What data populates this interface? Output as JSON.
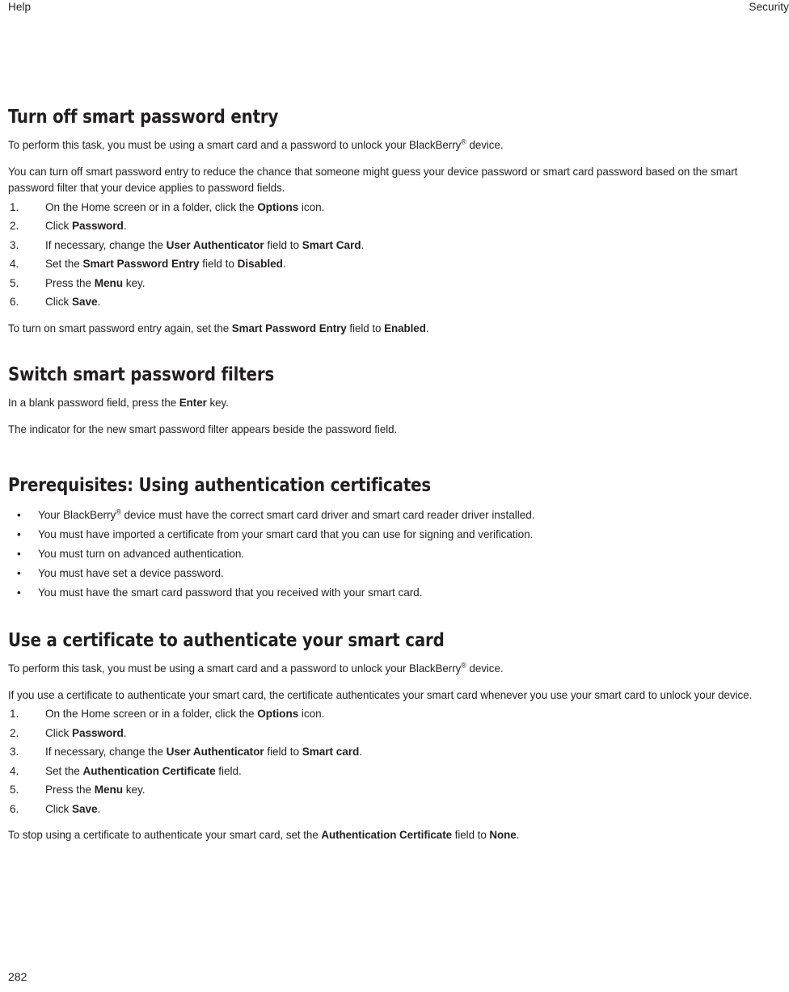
{
  "header": {
    "left": "Help",
    "right": "Security"
  },
  "footer": {
    "page_number": "282"
  },
  "sections": [
    {
      "id": "turn-off-smart-password-entry",
      "title": "Turn off smart password entry",
      "intro": "To perform this task, you must be using a smart card and a password to unlock your BlackBerry® device.",
      "description": "You can turn off smart password entry to reduce the chance that someone might guess your device password or smart card password based on the smart password filter that your device applies to password fields.",
      "steps": [
        {
          "num": "1.",
          "text": "On the Home screen or in a folder, click the Options icon."
        },
        {
          "num": "2.",
          "text": "Click Password."
        },
        {
          "num": "3.",
          "text": "If necessary, change the User Authenticator field to Smart Card."
        },
        {
          "num": "4.",
          "text": "Set the Smart Password Entry field to Disabled."
        },
        {
          "num": "5.",
          "text": "Press the Menu key."
        },
        {
          "num": "6.",
          "text": "Click Save."
        }
      ],
      "closing": "To turn on smart password entry again, set the Smart Password Entry field to Enabled."
    },
    {
      "id": "switch-smart-password-filters",
      "title": "Switch smart password filters",
      "intro": "In a blank password field, press the Enter key.",
      "closing": "The indicator for the new smart password filter appears beside the password field."
    },
    {
      "id": "prerequisites-using-authentication-certificates",
      "title": "Prerequisites: Using authentication certificates",
      "bullets": [
        "Your BlackBerry® device must have the correct smart card driver and smart card reader driver installed.",
        "You must have imported a certificate from your smart card that you can use for signing and verification.",
        "You must turn on advanced authentication.",
        "You must have set a device password.",
        "You must have the smart card password that you received with your smart card."
      ]
    },
    {
      "id": "use-a-certificate-to-authenticate-your-smart-card",
      "title": "Use a certificate to authenticate your smart card",
      "intro": "To perform this task, you must be using a smart card and a password to unlock your BlackBerry® device.",
      "description": "If you use a certificate to authenticate your smart card, the certificate authenticates your smart card whenever you use your smart card to unlock your device.",
      "steps": [
        {
          "num": "1.",
          "text": "On the Home screen or in a folder, click the Options icon."
        },
        {
          "num": "2.",
          "text": "Click Password."
        },
        {
          "num": "3.",
          "text": "If necessary, change the User Authenticator field to Smart card."
        },
        {
          "num": "4.",
          "text": "Set the Authentication Certificate field."
        },
        {
          "num": "5.",
          "text": "Press the Menu key."
        },
        {
          "num": "6.",
          "text": "Click Save."
        }
      ],
      "closing": "To stop using a certificate to authenticate your smart card, set the Authentication Certificate field to None."
    }
  ],
  "bullet_glyph": "•",
  "colors": {
    "text": "#231f20",
    "background": "#ffffff"
  }
}
